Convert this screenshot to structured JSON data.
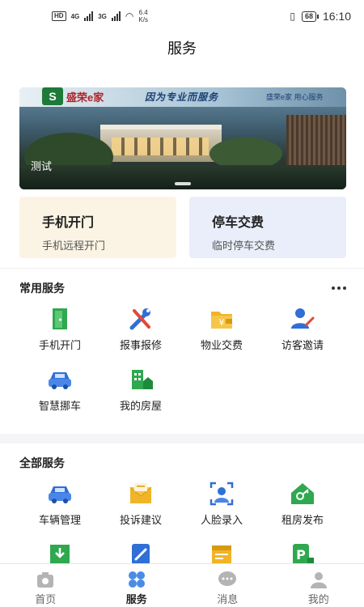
{
  "status_bar": {
    "network_tags": [
      "HD",
      "4G",
      "3G"
    ],
    "speed_value": "6.4",
    "speed_unit": "K/s",
    "battery": "68",
    "time": "16:10"
  },
  "header": {
    "title": "服务"
  },
  "banner": {
    "brand": "盛荣e家",
    "slogan": "因为专业而服务",
    "slogan_tail": "盛荣e家 用心服务",
    "caption": "测试"
  },
  "quick_cards": [
    {
      "title": "手机开门",
      "subtitle": "手机远程开门",
      "bg": "#fbf4e4"
    },
    {
      "title": "停车交费",
      "subtitle": "临时停车交费",
      "bg": "#e9eefa"
    }
  ],
  "common_services": {
    "title": "常用服务",
    "items": [
      {
        "label": "手机开门",
        "icon": "door-icon"
      },
      {
        "label": "报事报修",
        "icon": "repair-tools-icon"
      },
      {
        "label": "物业交费",
        "icon": "payment-folder-icon"
      },
      {
        "label": "访客邀请",
        "icon": "visitor-invite-icon"
      },
      {
        "label": "智慧挪车",
        "icon": "car-icon"
      },
      {
        "label": "我的房屋",
        "icon": "building-icon"
      }
    ]
  },
  "all_services": {
    "title": "全部服务",
    "items": [
      {
        "label": "车辆管理",
        "icon": "car-icon"
      },
      {
        "label": "投诉建议",
        "icon": "envelope-icon"
      },
      {
        "label": "人脸录入",
        "icon": "face-scan-icon"
      },
      {
        "label": "租房发布",
        "icon": "house-key-icon"
      },
      {
        "label": "",
        "icon": "download-box-icon"
      },
      {
        "label": "",
        "icon": "phone-call-icon"
      },
      {
        "label": "",
        "icon": "calendar-icon"
      },
      {
        "label": "",
        "icon": "parking-icon"
      }
    ]
  },
  "tab_bar": {
    "active": 1,
    "tabs": [
      {
        "label": "首页",
        "icon": "home-icon"
      },
      {
        "label": "服务",
        "icon": "service-grid-icon"
      },
      {
        "label": "消息",
        "icon": "message-icon"
      },
      {
        "label": "我的",
        "icon": "profile-icon"
      }
    ]
  },
  "colors": {
    "green": "#2fa84f",
    "blue": "#2f6fd6",
    "yellow": "#f0b429",
    "tab_active": "#4a8be6",
    "tab_inactive": "#b4b4b4"
  }
}
